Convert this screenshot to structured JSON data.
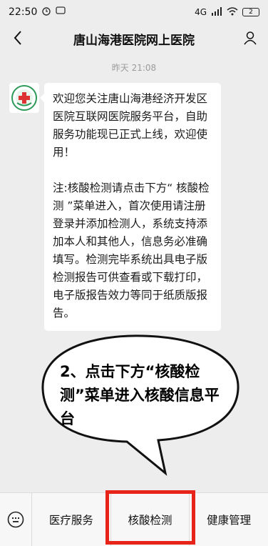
{
  "status": {
    "time": "22:50",
    "network": "4G",
    "battery": "2"
  },
  "header": {
    "title": "唐山海港医院网上医院"
  },
  "chat": {
    "timestamp": "昨天 21:08",
    "message": {
      "para1": "欢迎您关注唐山海港经济开发区医院互联网医院服务平台，自助服务功能现已正式上线，欢迎使用！",
      "para2": "注:核酸检测请点击下方“ 核酸检测 ”菜单进入，首次使用请注册登录并添加检测人，系统支持添加本人和其他人，信息务必准确填写。检测完毕系统出具电子版检测报告可供查看或下载打印，电子版报告效力等同于纸质版报告。"
    }
  },
  "callout": {
    "text": "2、点击下方“核酸检测”菜单进入核酸信息平台"
  },
  "menu": {
    "items": [
      {
        "label": "医疗服务"
      },
      {
        "label": "核酸检测"
      },
      {
        "label": "健康管理"
      }
    ]
  },
  "colors": {
    "highlight": "#e8231a",
    "background": "#ededed"
  }
}
